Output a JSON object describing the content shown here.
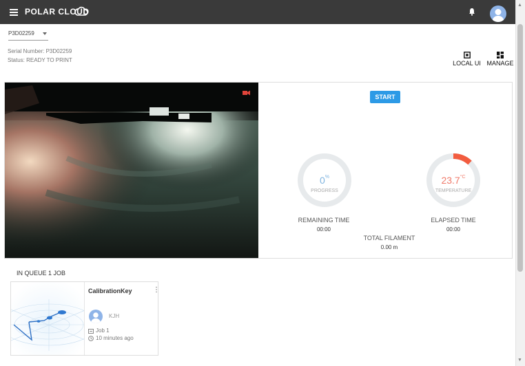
{
  "header": {
    "brand": "POLAR CLOUD",
    "colors": {
      "bar": "#3a3a3a",
      "accent": "#2d9ae6"
    }
  },
  "printer": {
    "selected": "P3D02259",
    "serial_text": "Serial Number: P3D02259",
    "status_text": "Status: READY TO PRINT"
  },
  "actions": {
    "local_ui": "LOCAL UI",
    "manage": "MANAGE"
  },
  "control": {
    "start_label": "START",
    "progress": {
      "value": "0",
      "unit": "%",
      "label": "PROGRESS",
      "fraction": 0
    },
    "temperature": {
      "value": "23.7",
      "unit": "°C",
      "label": "TEMPERATURE",
      "fraction": 0.12
    },
    "remaining": {
      "label": "REMAINING TIME",
      "value": "00:00"
    },
    "elapsed": {
      "label": "ELAPSED TIME",
      "value": "00:00"
    },
    "filament": {
      "label": "TOTAL FILAMENT",
      "value": "0.00 m"
    }
  },
  "queue": {
    "title": "IN QUEUE 1 JOB",
    "jobs": [
      {
        "name": "CalibrationKey",
        "user": "KJH",
        "job": "Job 1",
        "time": "10 minutes ago"
      }
    ]
  }
}
